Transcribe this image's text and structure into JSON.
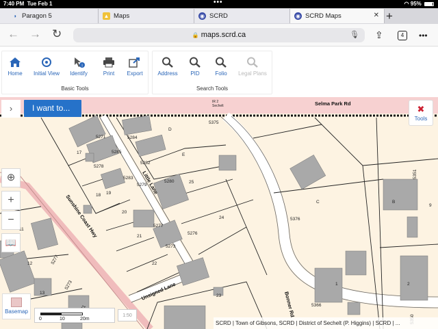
{
  "status": {
    "time": "7:40 PM",
    "date": "Tue Feb 1",
    "battery": "95%"
  },
  "tabs": [
    {
      "label": "Paragon 5"
    },
    {
      "label": "Maps"
    },
    {
      "label": "SCRD"
    },
    {
      "label": "SCRD Maps"
    }
  ],
  "address": {
    "url": "maps.scrd.ca",
    "tab_count": "4"
  },
  "ribbon": {
    "basic_tools": {
      "title": "Basic Tools",
      "buttons": [
        "Home",
        "Initial View",
        "Identify",
        "Print",
        "Export"
      ]
    },
    "search_tools": {
      "title": "Search Tools",
      "buttons": [
        "Address",
        "PID",
        "Folio",
        "Legal Plans"
      ]
    }
  },
  "map": {
    "i_want_label": "I want to...",
    "tools_label": "Tools",
    "basemap_label": "Basemap",
    "scale": {
      "labels": [
        "0",
        "10",
        "20m"
      ]
    },
    "scale_extra": "1:50",
    "attribution": "SCRD | Town of Gibsons, SCRD | District of Sechelt (P. Higgins) | SCRD | ...",
    "roads": {
      "selma": "Selma Park Rd",
      "sunshine": "Sunshine Coast Hwy",
      "little": "Little Lane",
      "unsigned": "Unsigned Lane",
      "bonner": "Bonner Rd",
      "sechelt_a": "IR 2",
      "sechelt_b": "Sechelt"
    },
    "lots": [
      "D",
      "E",
      "25",
      "24",
      "17",
      "18",
      "19",
      "20",
      "21",
      "22",
      "23",
      "C",
      "B",
      "2",
      "9",
      "11",
      "12",
      "13",
      "1"
    ],
    "addresses": [
      "5375",
      "5284",
      "5282",
      "5285",
      "5283",
      "5280",
      "5279",
      "5277",
      "5276",
      "5273",
      "5278",
      "5271",
      "5277",
      "5273",
      "5271",
      "5376",
      "5366",
      "5350",
      "5351"
    ]
  },
  "colors": {
    "accent": "#2672c9",
    "map_bg": "#fdf3e2",
    "road_pink": "#f4c6c6"
  }
}
